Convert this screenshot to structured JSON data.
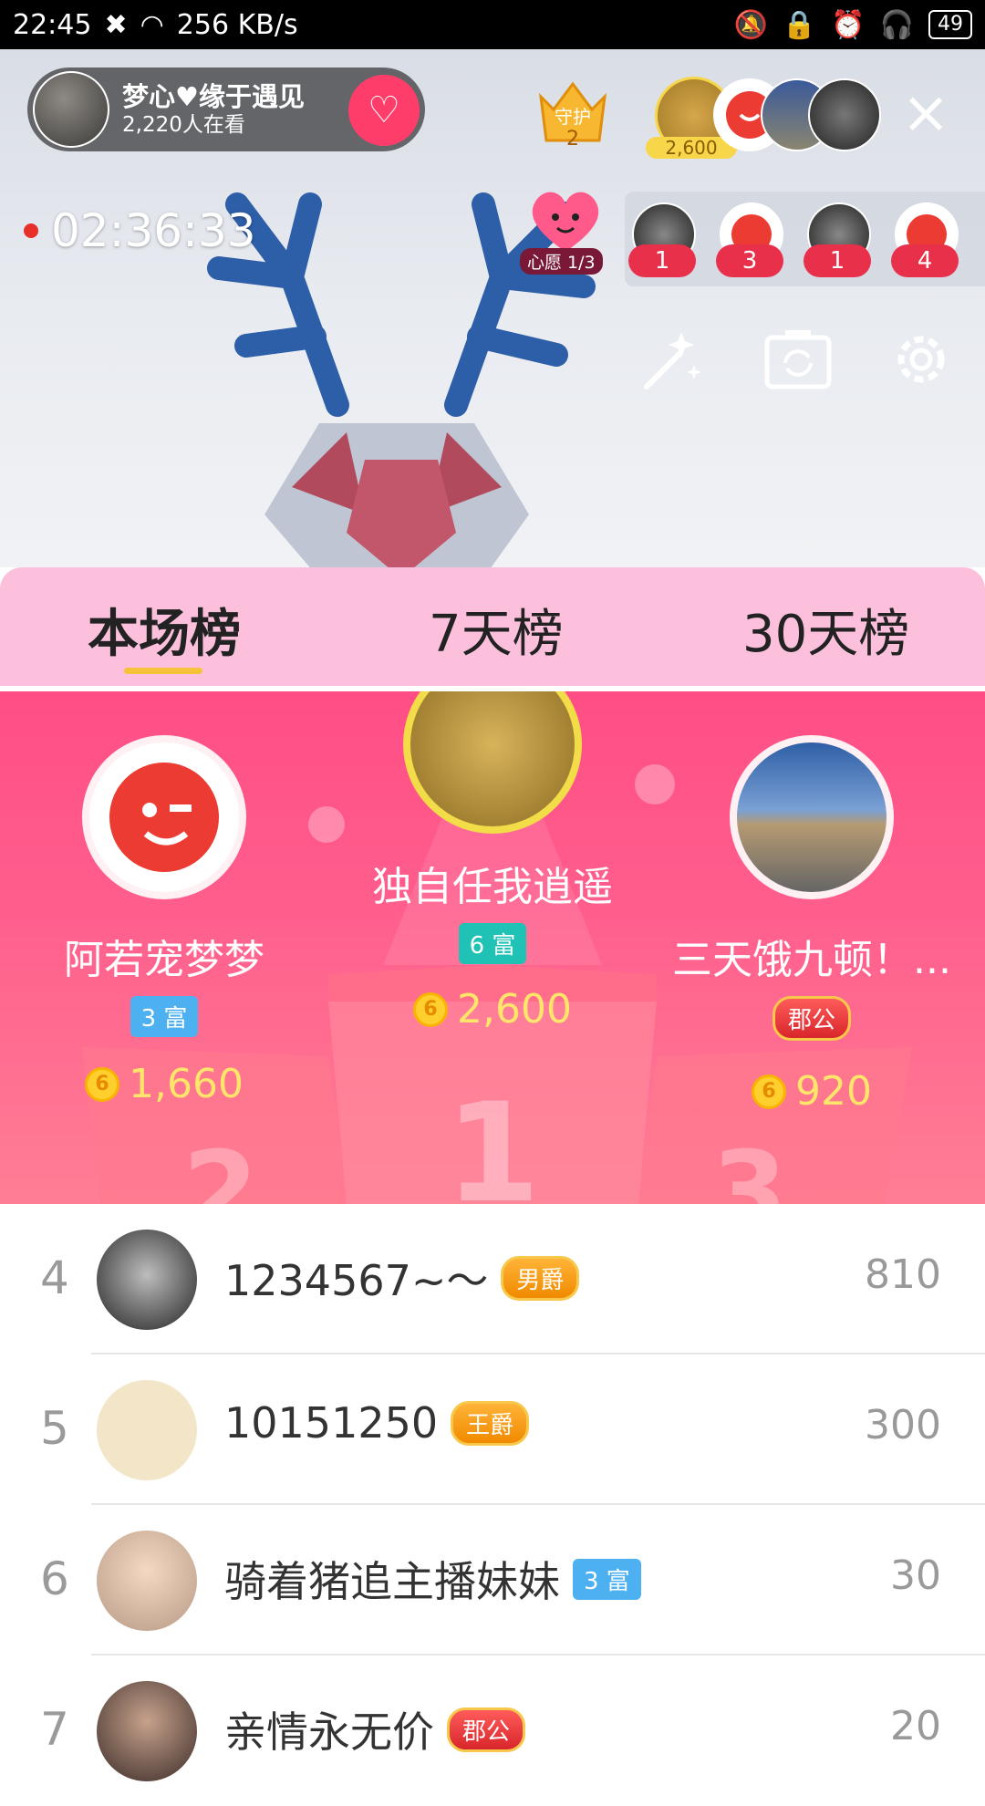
{
  "status_bar": {
    "time": "22:45",
    "net_speed": "256 KB/s",
    "battery": "49"
  },
  "live": {
    "host_name": "梦心♥缘于遇见",
    "viewers": "2,220人在看",
    "guard_label": "守护",
    "guard_count": "2",
    "top_fan_score": "2,600",
    "timer": "02:36:33",
    "wish_label": "心愿 1/3",
    "gift_counts": [
      "1",
      "3",
      "1",
      "4"
    ]
  },
  "tabs": [
    "本场榜",
    "7天榜",
    "30天榜"
  ],
  "podium": {
    "first": {
      "name": "独自任我逍遥",
      "badge": "6 富",
      "score": "2,600",
      "place": "1"
    },
    "second": {
      "name": "阿若宠梦梦",
      "badge": "3 富",
      "score": "1,660",
      "place": "2"
    },
    "third": {
      "name": "三天饿九顿！...",
      "badge": "郡公",
      "score": "920",
      "place": "3"
    }
  },
  "ranking": [
    {
      "rank": "4",
      "name": "1234567~〜",
      "badge": "男爵",
      "score": "810"
    },
    {
      "rank": "5",
      "name": "10151250",
      "badge": "王爵",
      "score": "300"
    },
    {
      "rank": "6",
      "name": "骑着猪追主播妹妹",
      "badge": "3 富",
      "score": "30"
    },
    {
      "rank": "7",
      "name": "亲情永无价",
      "badge": "郡公",
      "score": "20"
    }
  ],
  "colors": {
    "accent_pink": "#ff4e86",
    "tab_bg": "#fcc0dc",
    "gold_text": "#ffe66a"
  }
}
